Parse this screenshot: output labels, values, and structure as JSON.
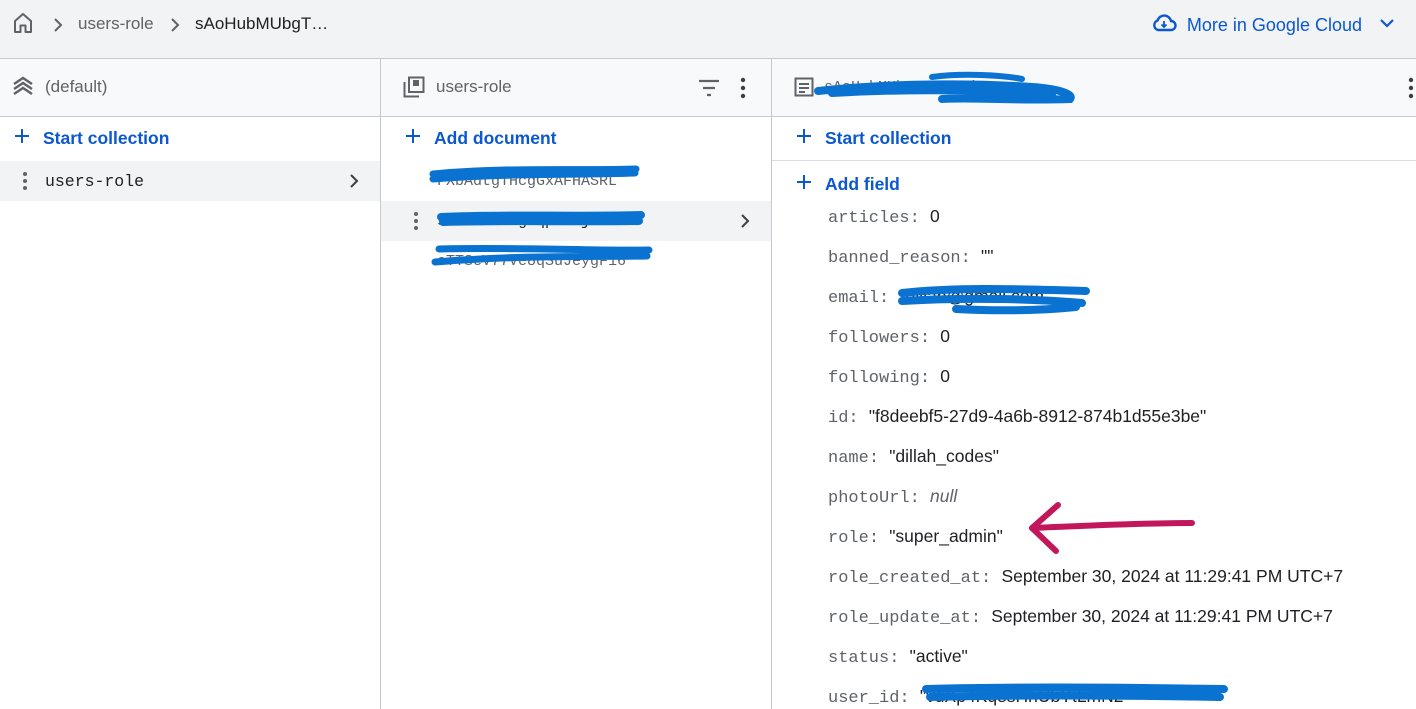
{
  "breadcrumb": {
    "items": [
      "users-role",
      "sAoHubMUbgT…"
    ]
  },
  "google_cloud": {
    "label": "More in Google Cloud"
  },
  "panel_database": {
    "title": "(default)",
    "start_collection": "Start collection",
    "collections": [
      {
        "name": "users-role"
      }
    ]
  },
  "panel_collection": {
    "title": "users-role",
    "add_document": "Add document",
    "documents": [
      "FXbAdtgTHcgGxAFHASRL",
      "sAoHubMUbgTqpKNuj",
      "oTTSeV77Ve8qSuJeygF16"
    ]
  },
  "panel_document": {
    "title": "sAoHubMUbgTqpKNuj",
    "start_collection": "Start collection",
    "add_field": "Add field",
    "fields": [
      {
        "key": "articles",
        "value": "0"
      },
      {
        "key": "banned_reason",
        "value": "\"\""
      },
      {
        "key": "email",
        "value": "\"dillah@gmail.com\""
      },
      {
        "key": "followers",
        "value": "0"
      },
      {
        "key": "following",
        "value": "0"
      },
      {
        "key": "id",
        "value": "\"f8deebf5-27d9-4a6b-8912-874b1d55e3be\""
      },
      {
        "key": "name",
        "value": "\"dillah_codes\""
      },
      {
        "key": "photoUrl",
        "value": "null"
      },
      {
        "key": "role",
        "value": "\"super_admin\""
      },
      {
        "key": "role_created_at",
        "value": "September 30, 2024 at 11:29:41 PM UTC+7"
      },
      {
        "key": "role_update_at",
        "value": "September 30, 2024 at 11:29:41 PM UTC+7"
      },
      {
        "key": "status",
        "value": "\"active\""
      },
      {
        "key": "user_id",
        "value": "\"vdXp4Kq8sHhUbYtLmN2\""
      }
    ]
  },
  "colors": {
    "accent": "#0b57d0",
    "annotation": "#c2185b",
    "redaction": "#0a73d1"
  }
}
